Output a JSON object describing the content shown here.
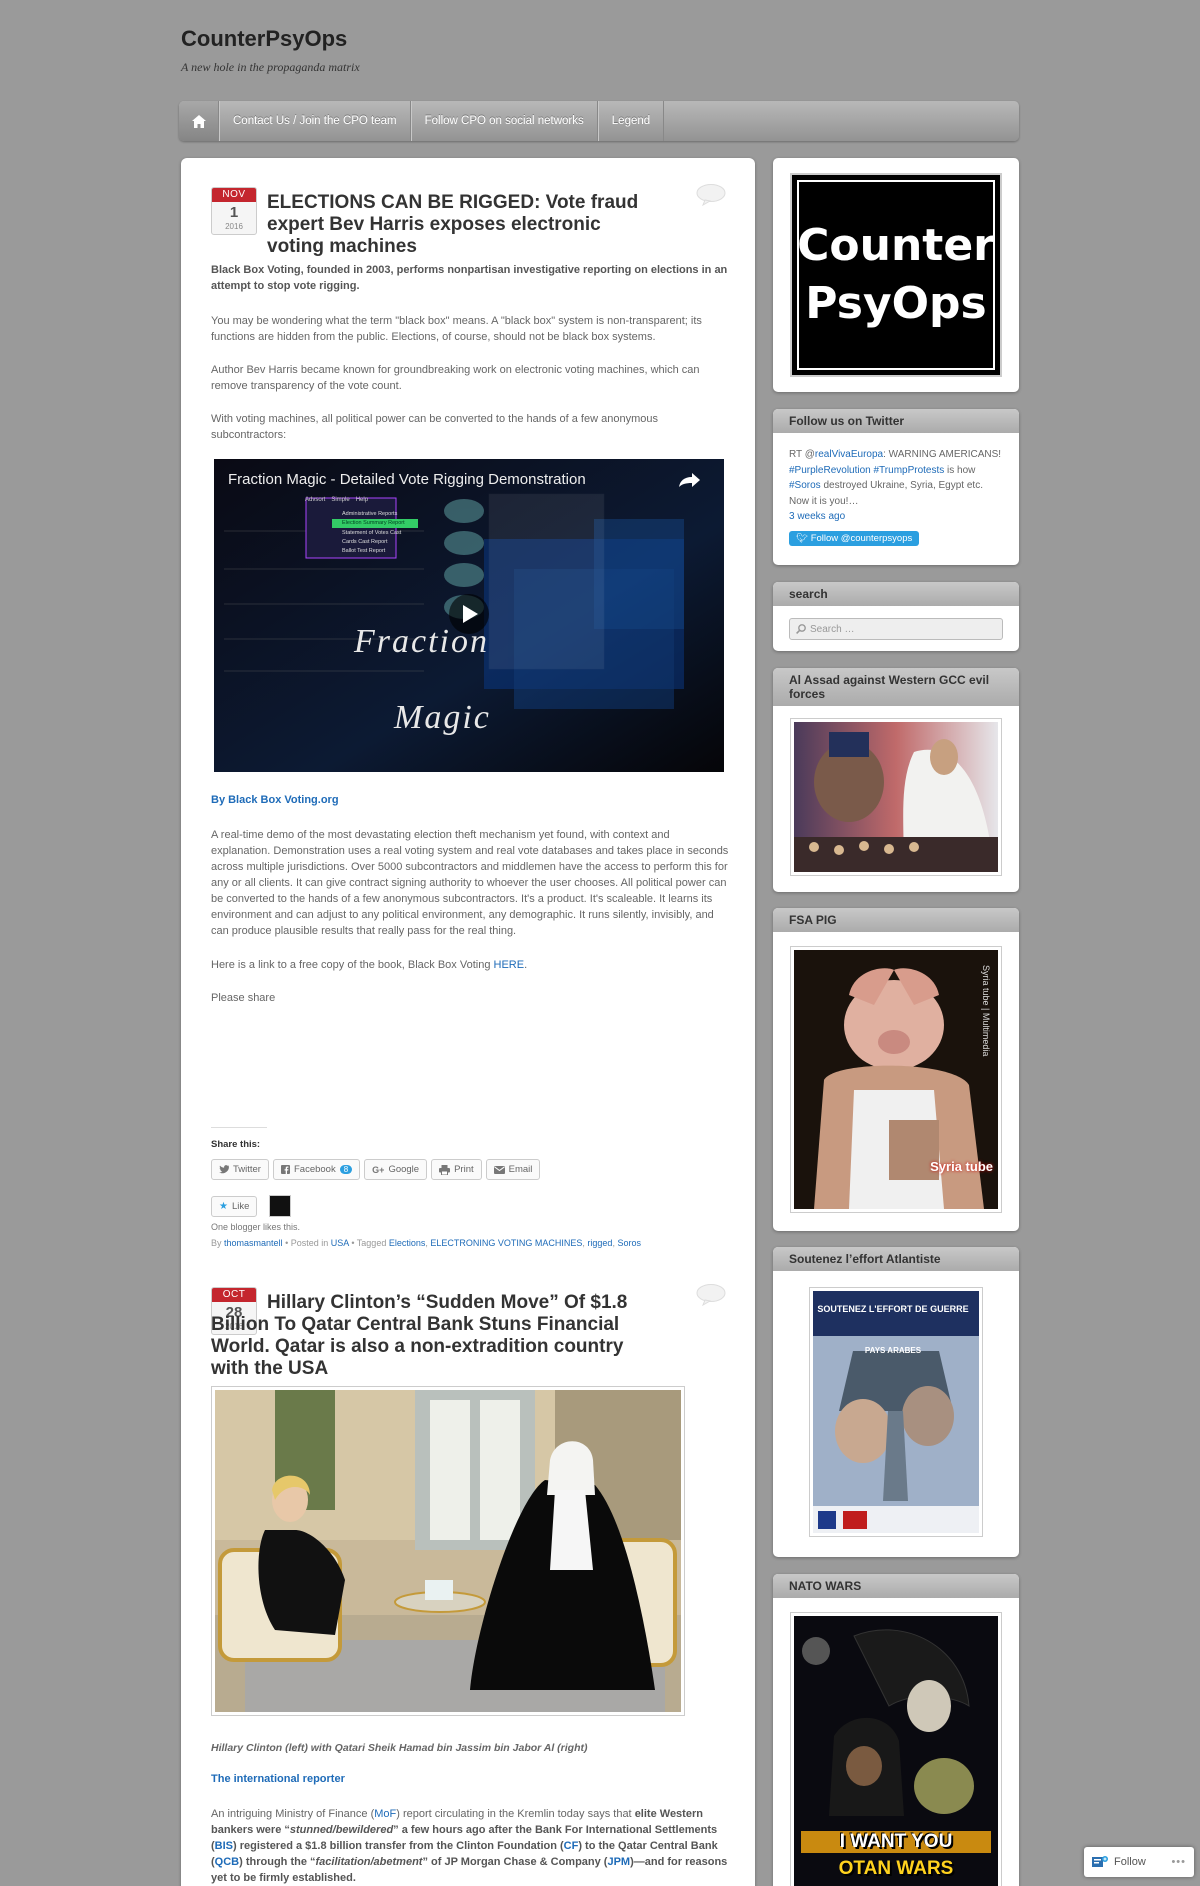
{
  "site": {
    "title": "CounterPsyOps",
    "description": "A new hole in the propaganda matrix"
  },
  "nav": {
    "items": [
      "Contact Us / Join the CPO team",
      "Follow CPO on social networks",
      "Legend"
    ]
  },
  "posts": [
    {
      "date": {
        "month": "NOV",
        "day": "1",
        "year": "2016"
      },
      "title": "ELECTIONS CAN BE RIGGED: Vote fraud expert Bev Harris exposes electronic voting machines",
      "intro": "Black Box Voting, founded in 2003, performs nonpartisan investigative reporting on elections in an attempt to stop vote rigging.",
      "p1": "You may be wondering what the term \"black box\" means. A \"black box\" system is non-transparent; its functions are hidden from the public. Elections, of course, should not be black box systems.",
      "p2": "Author Bev Harris became known for groundbreaking work on electronic voting machines, which can remove transparency of the vote count.",
      "p3": "With voting machines, all political power can be converted to the hands of a few anonymous subcontractors:",
      "video": {
        "title": "Fraction Magic - Detailed Vote Rigging Demonstration",
        "word1": "Fraction",
        "word2": "Magic",
        "menu": [
          "Advsort",
          "Simple",
          "Help"
        ],
        "menu_items": [
          "Administrative Reports",
          "Election Summary Report",
          "Statement of Votes Cast",
          "Cards Cast Report",
          "Ballot Test Report"
        ]
      },
      "byline": "By Black Box Voting.org",
      "p4": "A real-time demo of the most devastating election theft mechanism yet found, with context and explanation. Demonstration uses a real voting system and real vote databases and takes place in seconds across multiple jurisdictions. Over 5000 subcontractors and middlemen have the access to perform this for any or all clients. It can give contract signing authority to whoever the user chooses. All political power can be converted to the hands of a few anonymous subcontractors. It's a product. It's scaleable. It learns its environment and can adjust to any political environment, any demographic. It runs silently, invisibly, and can produce plausible results that really pass for the real thing.",
      "p5_prefix": "Here is a link to a free copy of the book, Black Box Voting ",
      "p5_link": "HERE",
      "p5_suffix": ".",
      "p6": "Please share",
      "share_label": "Share this:",
      "share_buttons": [
        "Twitter",
        "Facebook",
        "Google",
        "Print",
        "Email"
      ],
      "facebook_count": "8",
      "like_label": "Like",
      "likes_text": "One blogger likes this.",
      "meta": {
        "by": "By",
        "author": "thomasmantell",
        "posted_in": "• Posted in",
        "category": "USA",
        "tagged": "• Tagged",
        "tags": [
          "Elections",
          "ELECTRONING VOTING MACHINES",
          "rigged",
          "Soros"
        ]
      }
    },
    {
      "date": {
        "month": "OCT",
        "day": "28",
        "year": "2016"
      },
      "title": "Hillary Clinton’s “Sudden Move” Of $1.8 Billion To Qatar Central Bank Stuns Financial World. Qatar is also a non-extradition country with the USA",
      "caption": "Hillary Clinton (left) with Qatari Sheik Hamad bin Jassim bin Jabor Al (right)",
      "byline": "The international reporter",
      "p1": {
        "a": "An intriguing Ministry of Finance (",
        "mof": "MoF",
        "b": ") report circulating in the Kremlin today says that ",
        "c": "elite Western bankers were “",
        "d": "stunned/bewildered",
        "e": "” a few hours ago after the Bank For International Settlements (",
        "bis": "BIS",
        "f": ") registered a $1.8 billion transfer from the Clinton Foundation (",
        "cf": "CF",
        "g": ") to the Qatar Central Bank (",
        "qcb": "QCB",
        "h": ") through the “",
        "i": "facilitation/abetment",
        "j": "” of JP Morgan Chase & Company (",
        "jpm": "JPM",
        "k": ")—and for reasons yet to be firmly established."
      }
    }
  ],
  "sidebar": {
    "logo_text": [
      "Counter",
      "PsyOps"
    ],
    "twitter": {
      "title": "Follow us on Twitter",
      "rt": "RT @",
      "handle": "realVivaEuropa",
      "t1": ": WARNING AMERICANS! ",
      "tag1": "#PurpleRevolution",
      "t2": " ",
      "tag2": "#TrumpProtests",
      "t3": " is how ",
      "tag3": "#Soros",
      "t4": " destroyed Ukraine, Syria, Egypt etc. Now it is you!…",
      "time": "3 weeks ago",
      "follow_btn": "Follow @counterpsyops"
    },
    "search": {
      "title": "search",
      "placeholder": "Search …"
    },
    "w3": {
      "title": "Al Assad against Western GCC evil forces"
    },
    "w4": {
      "title": "FSA PIG",
      "watermark": "Syria tube | Multimedia",
      "logo": "Syria tube"
    },
    "w5": {
      "title": "Soutenez l’effort Atlantiste",
      "poster_header": "SOUTENEZ L'EFFORT DE GUERRE",
      "poster_sub": "PAYS ARABES"
    },
    "w6": {
      "title": "NATO WARS",
      "poster_text1": "I WANT YOU",
      "poster_text2": "OTAN WARS"
    }
  },
  "follow_float": {
    "label": "Follow"
  }
}
